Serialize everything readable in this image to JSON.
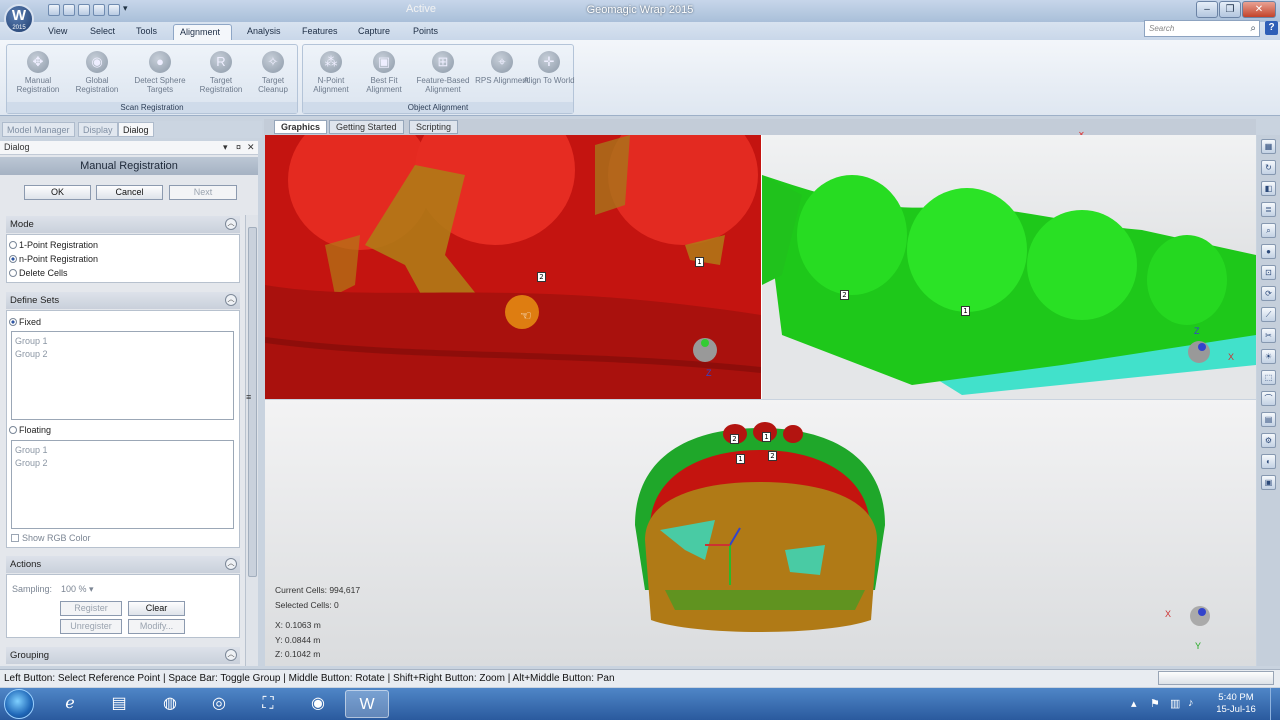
{
  "window": {
    "title": "Geomagic Wrap 2015",
    "active_label": "Active",
    "logo_text": "W",
    "logo_sub": "2015"
  },
  "menu": [
    "View",
    "Select",
    "Tools",
    "Alignment",
    "Analysis",
    "Features",
    "Capture",
    "Points"
  ],
  "search": {
    "placeholder": "Search"
  },
  "ribbon": {
    "scan_group": {
      "label": "Scan Registration",
      "buttons": [
        "Manual Registration",
        "Global Registration",
        "Detect Sphere Targets",
        "Target Registration",
        "Target Cleanup"
      ]
    },
    "object_group": {
      "label": "Object Alignment",
      "buttons": [
        "N-Point Alignment",
        "Best Fit Alignment",
        "Feature-Based Alignment",
        "RPS Alignment",
        "Align To World"
      ]
    }
  },
  "left_tabs": [
    "Model Manager",
    "Display",
    "Dialog"
  ],
  "panel": {
    "header": "Dialog",
    "title": "Manual Registration",
    "ok": "OK",
    "cancel": "Cancel",
    "next": "Next",
    "mode": {
      "label": "Mode",
      "options": [
        "1-Point Registration",
        "n-Point Registration",
        "Delete Cells"
      ],
      "selected": "n-Point Registration"
    },
    "define_sets": {
      "label": "Define Sets",
      "fixed": "Fixed",
      "fixed_items": [
        "Group 1",
        "Group 2"
      ],
      "floating": "Floating",
      "floating_items": [
        "Group 1",
        "Group 2"
      ],
      "show_rgb": "Show RGB Color"
    },
    "actions": {
      "label": "Actions",
      "sampling_label": "Sampling:",
      "sampling_value": "100 %",
      "register": "Register",
      "clear": "Clear",
      "unregister": "Unregister",
      "modify": "Modify..."
    },
    "grouping": {
      "label": "Grouping"
    }
  },
  "graphics_tabs": [
    "Graphics",
    "Getting Started",
    "Scripting"
  ],
  "viewport_markers": {
    "one": "1",
    "two": "2"
  },
  "axis_labels": {
    "x": "X",
    "y": "Y",
    "z": "Z"
  },
  "stats": {
    "current_cells": "Current Cells: 994,617",
    "selected_cells": "Selected Cells: 0",
    "x": "X:  0.1063 m",
    "y": "Y:  0.0844 m",
    "z": "Z:  0.1042 m"
  },
  "status_bar": "Left Button: Select Reference Point | Space Bar: Toggle Group | Middle Button: Rotate | Shift+Right Button: Zoom | Alt+Middle Button: Pan",
  "clock": {
    "time": "5:40 PM",
    "date": "15-Jul-16"
  },
  "colors": {
    "fixed_red": "#d61b15",
    "floating_green": "#1ec81a",
    "cyan": "#2fe0c8",
    "brown": "#b0781a"
  }
}
